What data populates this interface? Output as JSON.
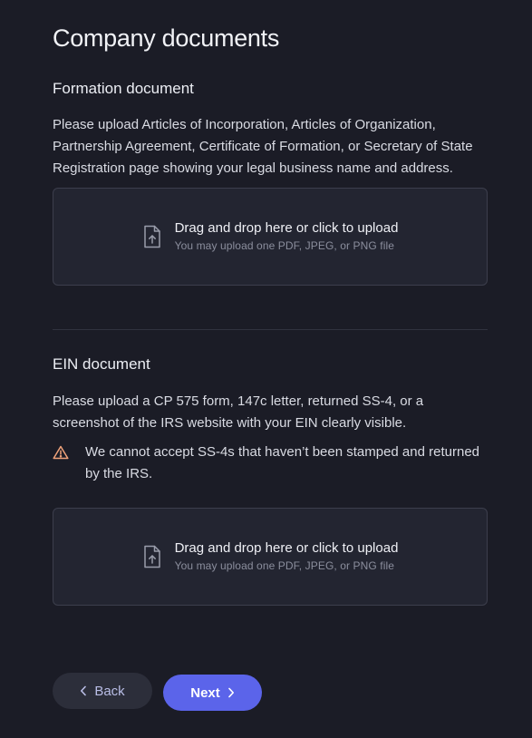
{
  "page": {
    "title": "Company documents"
  },
  "formation": {
    "title": "Formation document",
    "description": "Please upload Articles of Incorporation, Articles of Organization, Partnership Agreement, Certificate of Formation, or Secretary of State Registration page showing your legal business name and address.",
    "upload": {
      "main_text": "Drag and drop here or click to upload",
      "sub_text": "You may upload one PDF, JPEG, or PNG file",
      "icon": "file-upload-icon"
    }
  },
  "ein": {
    "title": "EIN document",
    "description": "Please upload a CP 575 form, 147c letter, returned SS-4, or a screenshot of the IRS website with your EIN clearly visible.",
    "warning": {
      "text": "We cannot accept SS-4s that haven’t been stamped and returned by the IRS.",
      "icon": "warning-icon",
      "color": "#f0a27a"
    },
    "upload": {
      "main_text": "Drag and drop here or click to upload",
      "sub_text": "You may upload one PDF, JPEG, or PNG file",
      "icon": "file-upload-icon"
    }
  },
  "nav": {
    "back_label": "Back",
    "next_label": "Next",
    "back_icon": "chevron-left-icon",
    "next_icon": "chevron-right-icon"
  },
  "colors": {
    "background": "#1b1c26",
    "accent": "#5b64ea",
    "warning": "#f0a27a"
  }
}
